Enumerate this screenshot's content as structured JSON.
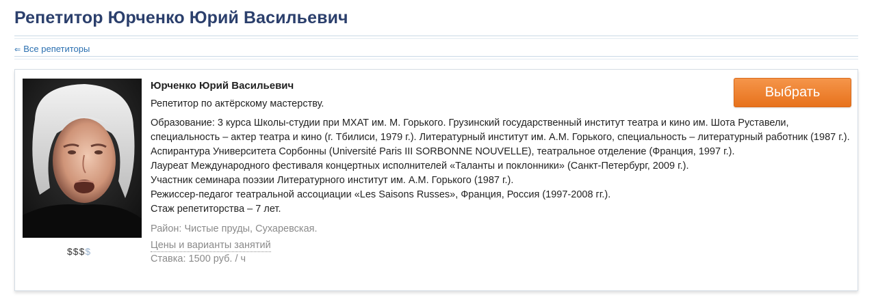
{
  "page": {
    "title": "Репетитор Юрченко Юрий Васильевич",
    "back_link": {
      "arrow": "⇐",
      "label": "Все репетиторы"
    }
  },
  "tutor": {
    "name": "Юрченко Юрий Васильевич",
    "subject": "Репетитор по актёрскому мастерству.",
    "bio": [
      "Образование: 3 курса Школы-студии при МХАТ им. М. Горького. Грузинский государственный институт театра и кино им. Шота Руставели, специальность – актер театра и кино (г. Тбилиси, 1979 г.). Литературный институт им. А.М. Горького, специальность – литературный работник (1987 г.). Аспирантура Университета Сорбонны (Université Paris III SORBONNE NOUVELLE), театральное отделение (Франция, 1997 г.).",
      "Лауреат Международного фестиваля концертных исполнителей «Таланты и поклонники» (Санкт-Петербург, 2009 г.).",
      "Участник семинара поэзии Литературного институт им. А.М. Горького (1987 г.).",
      "Режиссер-педагог театральной ассоциации «Les Saisons Russes», Франция, Россия (1997-2008 гг.).",
      "Стаж репетиторства – 7 лет."
    ],
    "district": "Район: Чистые пруды, Сухаревская.",
    "prices_link": "Цены и варианты занятий",
    "rate": "Ставка: 1500 руб. / ч",
    "price_level": {
      "filled": "$$$",
      "empty": "$",
      "value": "3 of 4"
    },
    "choose_button": "Выбрать"
  },
  "colors": {
    "title": "#2b3f6c",
    "link": "#2a6fb0",
    "button": "#ee7f2d",
    "muted": "#8a8a8a"
  }
}
